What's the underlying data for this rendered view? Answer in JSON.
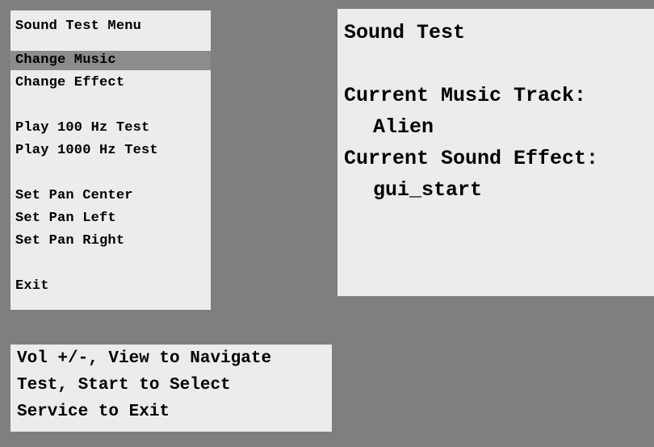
{
  "menu": {
    "title": "Sound Test Menu",
    "selected_index": 0,
    "items": [
      {
        "label": "Change Music"
      },
      {
        "label": "Change Effect"
      },
      {
        "label": "Play 100 Hz Test"
      },
      {
        "label": "Play 1000 Hz Test"
      },
      {
        "label": "Set Pan Center"
      },
      {
        "label": "Set Pan Left"
      },
      {
        "label": "Set Pan Right"
      },
      {
        "label": "Exit"
      }
    ]
  },
  "info": {
    "title": "Sound Test",
    "music_label": "Current Music Track:",
    "music_value": "Alien",
    "effect_label": "Current Sound Effect:",
    "effect_value": "gui_start"
  },
  "help": {
    "lines": [
      "Vol +/-, View to Navigate",
      "Test, Start to Select",
      "Service to Exit"
    ]
  },
  "colors": {
    "background": "#7f7f7f",
    "panel": "#ececec",
    "highlight": "#8c8c8c",
    "text": "#000000"
  }
}
